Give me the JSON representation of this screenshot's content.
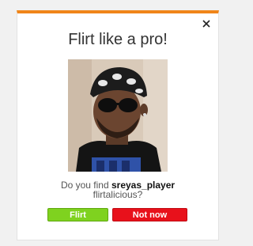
{
  "dialog": {
    "title": "Flirt like a pro!",
    "close_glyph": "×",
    "question_prefix": "Do you find",
    "username": "sreyas_player",
    "question_suffix": "flirtalicious?",
    "photo_icon": "profile-photo",
    "buttons": {
      "flirt_label": "Flirt",
      "not_now_label": "Not now"
    }
  },
  "colors": {
    "accent": "#f08519",
    "flirt": "#7fd21f",
    "not_now": "#e8111b"
  }
}
